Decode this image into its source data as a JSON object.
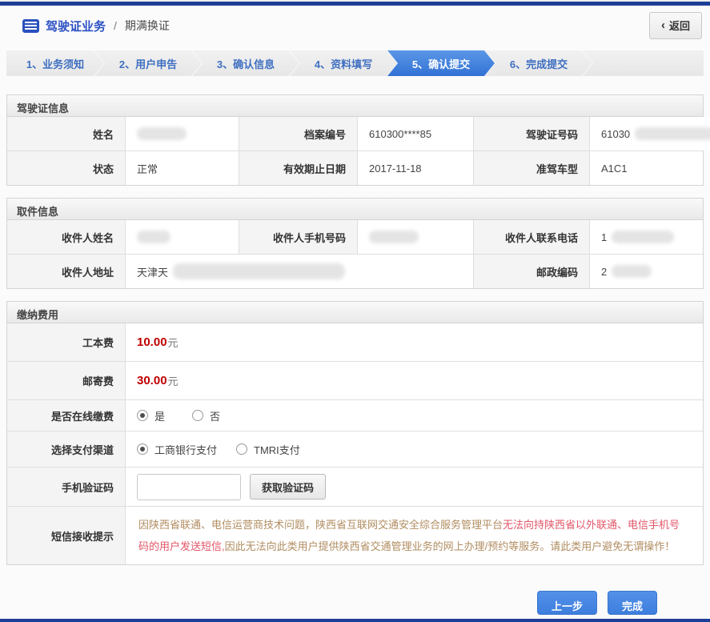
{
  "header": {
    "title": "驾驶证业务",
    "divider": "/",
    "subtitle": "期满换证",
    "back_chevron": "‹",
    "back_label": "返回"
  },
  "steps": {
    "active_index": 4,
    "items": [
      {
        "label": "1、业务须知"
      },
      {
        "label": "2、用户申告"
      },
      {
        "label": "3、确认信息"
      },
      {
        "label": "4、资料填写"
      },
      {
        "label": "5、确认提交"
      },
      {
        "label": "6、完成提交"
      }
    ]
  },
  "license": {
    "title": "驾驶证信息",
    "name_label": "姓名",
    "name_value": "",
    "file_no_label": "档案编号",
    "file_no_value": "610300****85",
    "license_no_label": "驾驶证号码",
    "license_no_value": "61030",
    "status_label": "状态",
    "status_value": "正常",
    "expiry_label": "有效期止日期",
    "expiry_value": "2017-11-18",
    "vehicle_label": "准驾车型",
    "vehicle_value": "A1C1"
  },
  "pickup": {
    "title": "取件信息",
    "recipient_label": "收件人姓名",
    "recipient_value": "",
    "mobile_label": "收件人手机号码",
    "mobile_value": "",
    "tel_label": "收件人联系电话",
    "tel_value": "1",
    "address_label": "收件人地址",
    "address_value": "天津天",
    "zip_label": "邮政编码",
    "zip_value": "2"
  },
  "payment": {
    "title": "缴纳费用",
    "work_fee_label": "工本费",
    "work_fee_value": "10.00",
    "work_fee_unit": "元",
    "post_fee_label": "邮寄费",
    "post_fee_value": "30.00",
    "post_fee_unit": "元",
    "online_label": "是否在线缴费",
    "online_yes": "是",
    "online_no": "否",
    "online_selected": "是",
    "channel_label": "选择支付渠道",
    "channel_icbc": "工商银行支付",
    "channel_tmri": "TMRI支付",
    "channel_selected": "工商银行支付",
    "code_label": "手机验证码",
    "code_value": "",
    "code_button": "获取验证码",
    "notice_label": "短信接收提示",
    "notice_part1": "因陕西省联通、电信运营商技术问题，陕西省互联网交通安全综合服务管理平台",
    "notice_part2": "无法向持陕西省以外联通、电信手机号码的用户发送短信,",
    "notice_part3": "因此无法向此类用户提供陕西省交通管理业务的网上办理/预约等服务。请此类用户避免无谓操作！"
  },
  "footer": {
    "prev": "上一步",
    "finish": "完成"
  },
  "colors": {
    "navy_bar": "#1d3e96",
    "step_text_blue": "#3f6fc1",
    "active_step_blue": "#3b7dd8",
    "fee_red": "#c00000",
    "notice_tan": "#b18d61",
    "notice_red": "#e25668",
    "button_blue": "#4285e4"
  }
}
